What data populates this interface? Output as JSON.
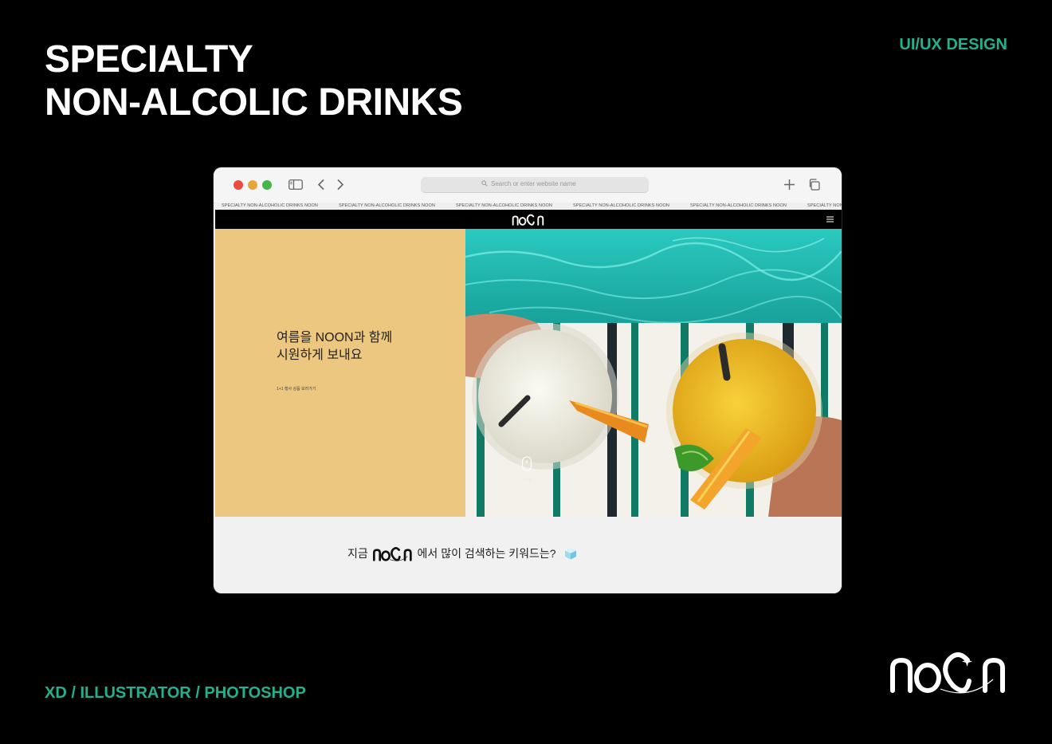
{
  "poster": {
    "title_line1": "SPECIALTY",
    "title_line2": "NON-ALCOLIC DRINKS",
    "corner_tag": "UI/UX DESIGN",
    "tools": "XD / ILLUSTRATOR / PHOTOSHOP",
    "brand_logo": "noon-logo",
    "colors": {
      "background": "#000000",
      "accent": "#23b08e",
      "hero_panel": "#ecc77f"
    }
  },
  "browser": {
    "address_placeholder": "Search or enter website name",
    "icons": [
      "sidebar-icon",
      "back-icon",
      "forward-icon",
      "search-icon",
      "new-tab-icon",
      "tabs-overview-icon"
    ]
  },
  "site": {
    "ticker_text": "SPECIALTY NON-ALCOHOLIC DRINKS NOON",
    "nav_logo": "noon-logo",
    "hero": {
      "headline_line1": "여름을 NOON과 함께",
      "headline_line2": "시원하게 보내요",
      "link": "1+1 행사 상품 보러가기",
      "scroll_label": "Scroll"
    },
    "keywords": {
      "prefix": "지금",
      "suffix": "에서 많이 검색하는 키워드는?"
    }
  }
}
